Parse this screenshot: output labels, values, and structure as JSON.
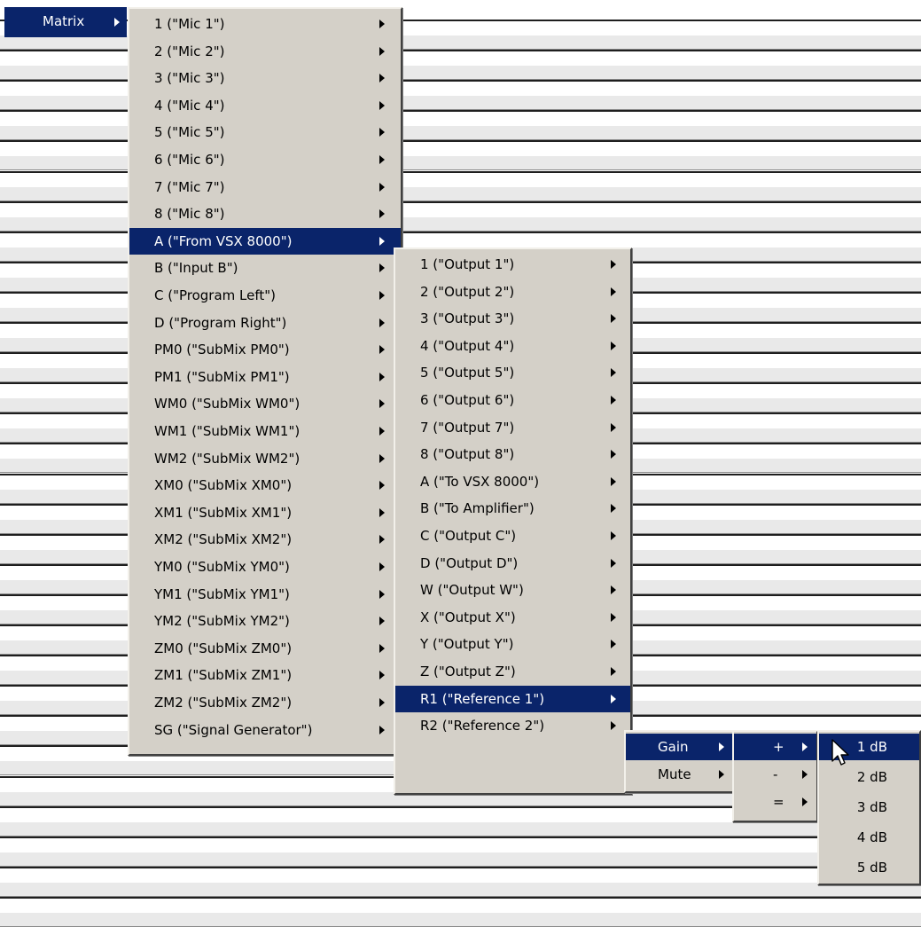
{
  "top_item": {
    "label": "Matrix"
  },
  "menu1": {
    "items": [
      "1 (\"Mic 1\")",
      "2 (\"Mic 2\")",
      "3 (\"Mic 3\")",
      "4 (\"Mic 4\")",
      "5 (\"Mic 5\")",
      "6 (\"Mic 6\")",
      "7 (\"Mic 7\")",
      "8 (\"Mic 8\")",
      "A (\"From VSX 8000\")",
      "B (\"Input B\")",
      "C (\"Program Left\")",
      "D (\"Program Right\")",
      "PM0 (\"SubMix PM0\")",
      "PM1 (\"SubMix PM1\")",
      "WM0 (\"SubMix WM0\")",
      "WM1 (\"SubMix WM1\")",
      "WM2 (\"SubMix WM2\")",
      "XM0 (\"SubMix XM0\")",
      "XM1 (\"SubMix XM1\")",
      "XM2 (\"SubMix XM2\")",
      "YM0 (\"SubMix YM0\")",
      "YM1 (\"SubMix YM1\")",
      "YM2 (\"SubMix YM2\")",
      "ZM0 (\"SubMix ZM0\")",
      "ZM1 (\"SubMix ZM1\")",
      "ZM2 (\"SubMix ZM2\")",
      "SG (\"Signal Generator\")"
    ],
    "highlighted": 8
  },
  "menu2": {
    "items": [
      "1 (\"Output 1\")",
      "2 (\"Output 2\")",
      "3 (\"Output 3\")",
      "4 (\"Output 4\")",
      "5 (\"Output 5\")",
      "6 (\"Output 6\")",
      "7 (\"Output 7\")",
      "8 (\"Output 8\")",
      "A (\"To VSX 8000\")",
      "B (\"To Amplifier\")",
      "C (\"Output C\")",
      "D (\"Output D\")",
      "W (\"Output W\")",
      "X (\"Output X\")",
      "Y (\"Output Y\")",
      "Z (\"Output Z\")",
      "R1 (\"Reference 1\")",
      "R2 (\"Reference 2\")"
    ],
    "highlighted": 16
  },
  "menu3": {
    "items": [
      "Gain",
      "Mute"
    ],
    "highlighted": 0
  },
  "menu4": {
    "items": [
      "+",
      "-",
      "="
    ],
    "highlighted": 0
  },
  "menu5": {
    "items": [
      "1 dB",
      "2 dB",
      "3 dB",
      "4 dB",
      "5 dB"
    ],
    "highlighted": 0
  },
  "colors": {
    "highlight": "#0a246a",
    "menu_bg": "#d4d0c8"
  }
}
